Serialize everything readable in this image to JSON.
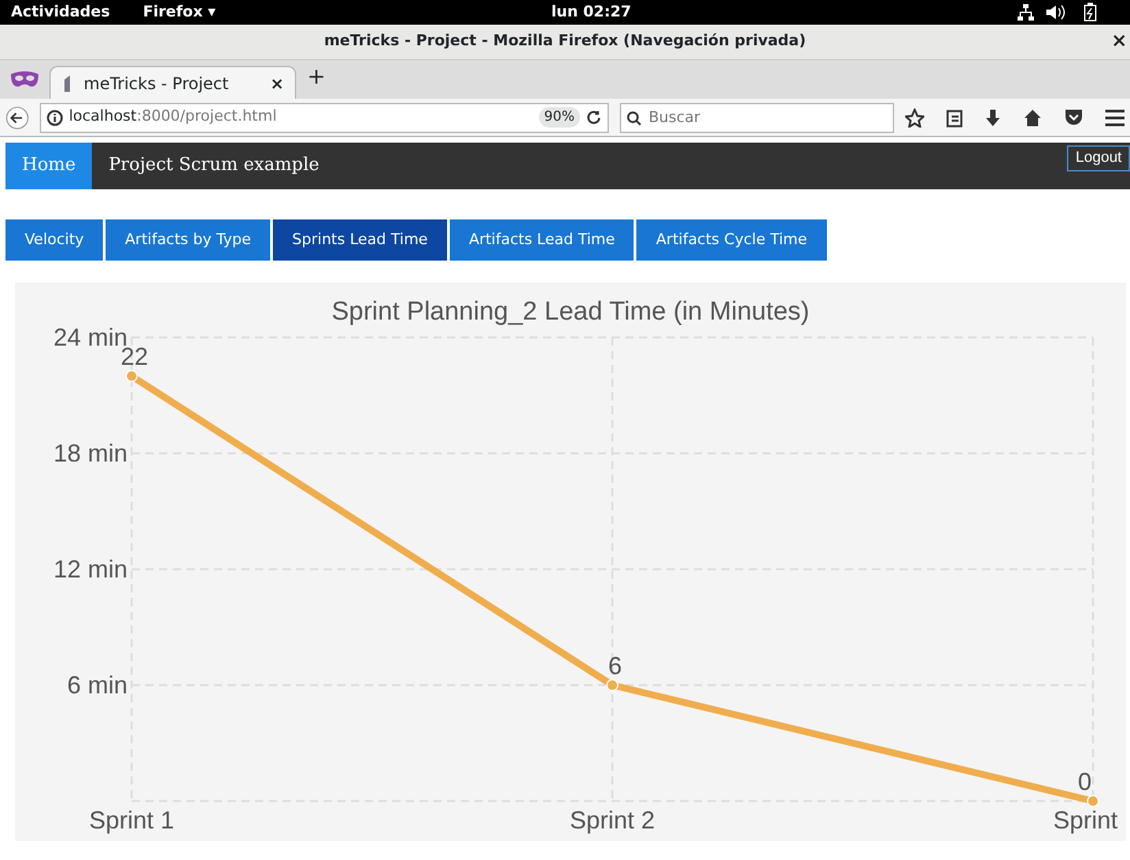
{
  "system_bar": {
    "activities": "Actividades",
    "app_menu": "Firefox ▾",
    "clock": "lun 02:27"
  },
  "window": {
    "title": "meTricks - Project - Mozilla Firefox (Navegación privada)",
    "close": "×"
  },
  "browser_tabs": [
    {
      "label": "meTricks - Project",
      "close": "×",
      "selected": true
    }
  ],
  "new_tab": "+",
  "address_bar": {
    "host": "localhost",
    "path": ":8000/project.html",
    "zoom": "90%"
  },
  "search": {
    "placeholder": "Buscar"
  },
  "navbar": {
    "items": [
      {
        "label": "Home",
        "selected": true
      },
      {
        "label": "Project Scrum example",
        "selected": false
      }
    ],
    "logout": "Logout"
  },
  "chart_tabs": [
    {
      "label": "Velocity",
      "selected": false
    },
    {
      "label": "Artifacts by Type",
      "selected": false
    },
    {
      "label": "Sprints Lead Time",
      "selected": true
    },
    {
      "label": "Artifacts Lead Time",
      "selected": false
    },
    {
      "label": "Artifacts Cycle Time",
      "selected": false
    }
  ],
  "chart": {
    "chart_data": {
      "type": "line",
      "title": "Sprint Planning_2 Lead Time (in Minutes)",
      "categories": [
        "Sprint 1",
        "Sprint 2",
        "Sprint"
      ],
      "series": [
        {
          "color": "#f0ad4e",
          "marker": true,
          "values": [
            22,
            6,
            0
          ]
        }
      ],
      "grid": true,
      "ylim": [
        0,
        24
      ],
      "yticks": [
        {
          "value": 6,
          "label": "6 min"
        },
        {
          "value": 12,
          "label": "12 min"
        },
        {
          "value": 18,
          "label": "18 min"
        },
        {
          "value": 24,
          "label": "24 min"
        }
      ],
      "data_labels": true
    }
  }
}
